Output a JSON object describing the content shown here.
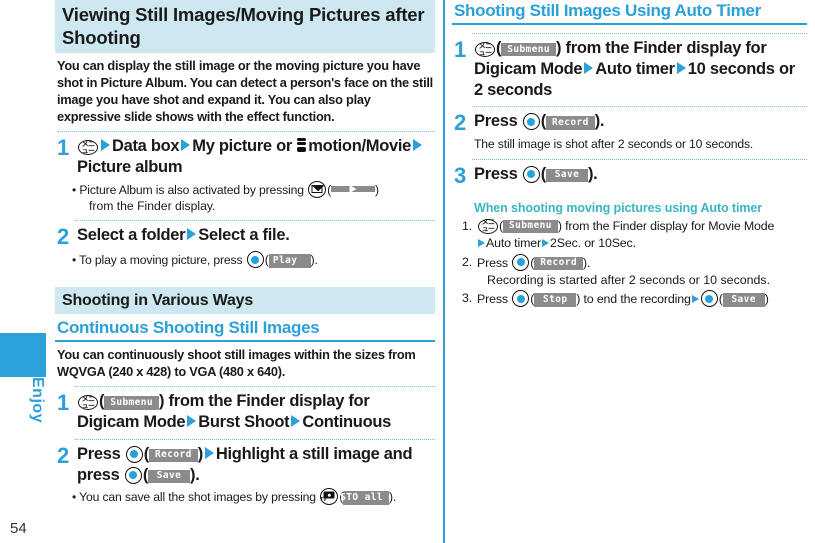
{
  "page": {
    "number": "54",
    "side_tab_label": "Enjoy"
  },
  "left_column": {
    "heading": "Viewing Still Images/Moving Pictures after Shooting",
    "intro": "You can display the still image or the moving picture you have shot in Picture Album. You can detect a person's face on the still image you have shot and expand it. You can also play expressive slide shows with the effect function.",
    "step1": {
      "number": "1",
      "text_a": "Data box",
      "text_b": "My picture or",
      "text_c": "motion/Movie",
      "text_d": "Picture album",
      "bullet": "Picture Album is also activated by pressing",
      "bullet_cont": "from the Finder display."
    },
    "step2": {
      "number": "2",
      "text_a": "Select a folder",
      "text_b": "Select a file.",
      "bullet": "To play a moving picture, press",
      "bullet_softkey": "Play",
      "bullet_end": ")."
    },
    "section_heading": "Shooting in Various Ways",
    "subsection_heading": "Continuous Shooting Still Images",
    "subsection_intro": "You can continuously shoot still images within the sizes from WQVGA (240 x 428) to VGA (480 x 640).",
    "cs_step1": {
      "number": "1",
      "softkey": "Submenu",
      "text_a": ") from the Finder display for Digicam Mode",
      "text_b": "Burst Shoot",
      "text_c": "Continuous"
    },
    "cs_step2": {
      "number": "2",
      "press": "Press",
      "softkey_record": "Record",
      "text_a": "Highlight a still image and press",
      "softkey_save": "Save",
      "text_end": ").",
      "bullet": "You can save all the shot images by pressing",
      "bullet_softkey": "STO all",
      "bullet_end": ")."
    }
  },
  "right_column": {
    "heading": "Shooting Still Images Using Auto Timer",
    "step1": {
      "number": "1",
      "softkey": "Submenu",
      "text_a": ") from the Finder display for Digicam Mode",
      "text_b": "Auto timer",
      "text_c": "10 seconds or 2 seconds"
    },
    "step2": {
      "number": "2",
      "press": "Press",
      "softkey": "Record",
      "text_end": ").",
      "note": "The still image is shot after 2 seconds or 10 seconds."
    },
    "step3": {
      "number": "3",
      "press": "Press",
      "softkey": "Save",
      "text_end": ")."
    },
    "sub_heading": "When shooting moving pictures using Auto timer",
    "sub_items": [
      {
        "num": "1.",
        "softkey": "Submenu",
        "text_a": ") from the Finder display for Movie Mode",
        "text_b": "Auto timer",
        "text_c": "2Sec. or 10Sec."
      },
      {
        "num": "2.",
        "press": "Press",
        "softkey": "Record",
        "text_end": ").",
        "note": "Recording is started after 2 seconds or 10 seconds."
      },
      {
        "num": "3.",
        "press": "Press",
        "softkey_stop": "Stop",
        "text_mid": ") to end the recording",
        "softkey_save": "Save",
        "text_end": ")"
      }
    ]
  },
  "icons": {
    "menu_key": "メニュー",
    "colors": {
      "accent_blue": "#2ba0d9",
      "heading_band": "#cde8f0",
      "teal": "#3ab5c4",
      "softkey_gray": "#8b8b8b"
    }
  }
}
